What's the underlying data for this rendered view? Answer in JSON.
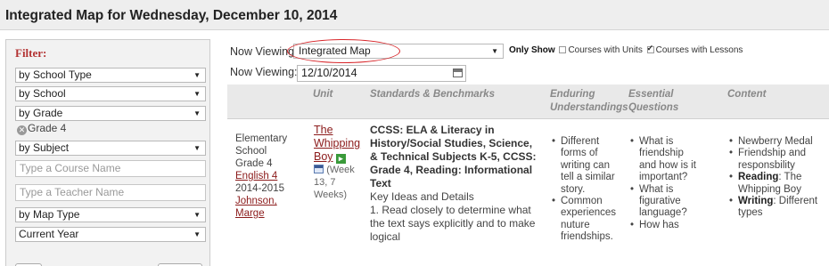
{
  "page": {
    "title": "Integrated Map for Wednesday, December 10, 2014"
  },
  "filter": {
    "header": "Filter:",
    "school_type": "by School Type",
    "school": "by School",
    "grade": "by Grade",
    "grade_chip": "Grade 4",
    "subject": "by Subject",
    "course_placeholder": "Type a Course Name",
    "teacher_placeholder": "Type a Teacher Name",
    "map_type": "by Map Type",
    "year": "Current Year"
  },
  "viewing": {
    "label": "Now Viewing:",
    "map_value": "Integrated Map",
    "only_show": "Only Show",
    "units_label": "Courses with Units",
    "units_checked": false,
    "lessons_label": "Courses with Lessons",
    "lessons_checked": true,
    "date_label": "Now Viewing:",
    "date_value": "12/10/2014"
  },
  "table": {
    "headers": {
      "unit": "Unit",
      "standards": "Standards & Benchmarks",
      "enduring1": "Enduring",
      "enduring2": "Understandings",
      "essential1": "Essential",
      "essential2": "Questions",
      "content": "Content"
    },
    "row": {
      "school_type": "Elementary School",
      "grade": "Grade 4",
      "course": "English 4",
      "year": "2014-2015",
      "teacher": "Johnson, Marge",
      "unit_title": "The Whipping Boy",
      "unit_weeks": "(Week 13, 7 Weeks)",
      "standard_title": "CCSS: ELA & Literacy in History/Social Studies, Science, & Technical Subjects K-5, CCSS: Grade 4, Reading: Informational Text",
      "standard_sub": "Key Ideas and Details",
      "standard_item": "1. Read closely to determine what the text says explicitly and to make logical",
      "enduring": [
        "Different forms of writing can tell a similar story.",
        "Common experiences nuture friendships."
      ],
      "questions": [
        "What is friendship and how is it important?",
        "What is figurative language?",
        "How has"
      ],
      "content": [
        {
          "bold": "",
          "text": "Newberry Medal"
        },
        {
          "bold": "",
          "text": "Friendship and responsbility"
        },
        {
          "bold": "Reading",
          "text": ": The Whipping Boy"
        },
        {
          "bold": "Writing",
          "text": ": Different types"
        }
      ]
    }
  },
  "colors": {
    "accent_red": "#b33333",
    "link": "#8b1a1a",
    "annotation": "#d8262a"
  },
  "icons": [
    "remove-icon",
    "dropdown-arrow-icon",
    "calendar-icon",
    "go-arrow-icon"
  ]
}
